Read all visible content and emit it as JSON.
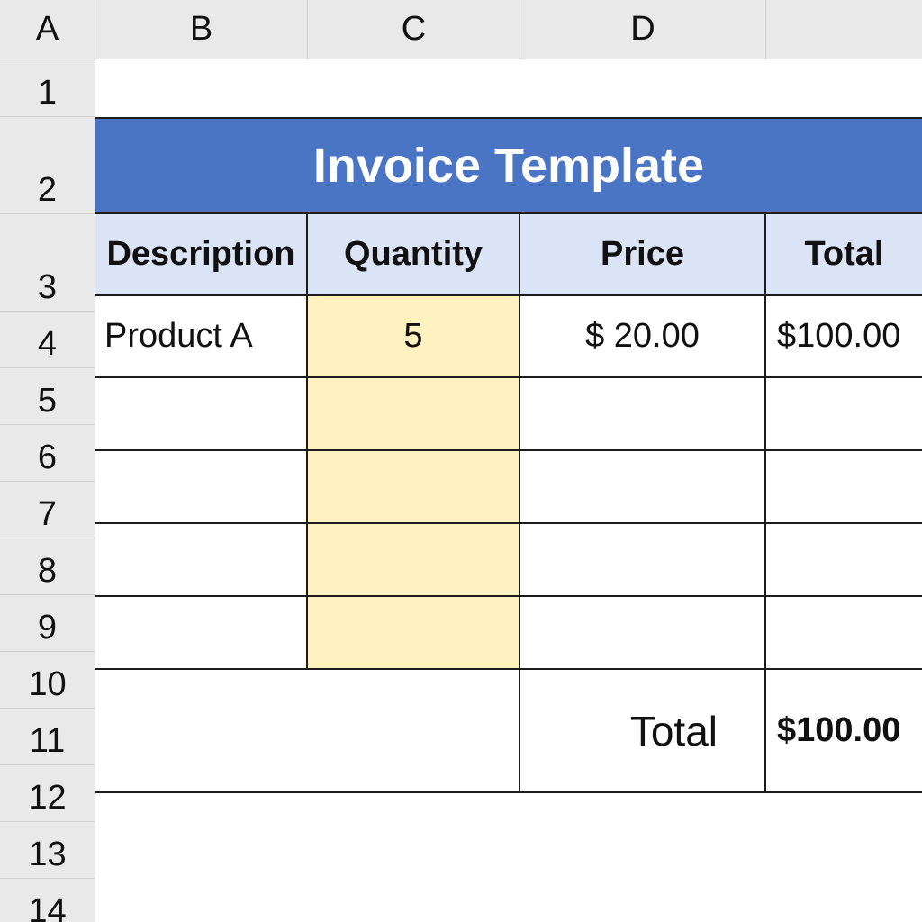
{
  "columns": [
    "A",
    "B",
    "C",
    "D"
  ],
  "rows": [
    "1",
    "2",
    "3",
    "4",
    "5",
    "6",
    "7",
    "8",
    "9",
    "10",
    "11",
    "12",
    "13",
    "14"
  ],
  "title": "Invoice Template",
  "table": {
    "headers": [
      "Description",
      "Quantity",
      "Price",
      "Total"
    ],
    "items": [
      {
        "description": "Product A",
        "quantity": "5",
        "price": "$ 20.00",
        "total": "$100.00"
      }
    ]
  },
  "summary": {
    "label": "Total",
    "value": "$100.00"
  },
  "colors": {
    "title_fill": "#4a74c4",
    "header_fill": "#dbe4f4",
    "quantity_fill": "#fff2c0",
    "grid_header": "#e9e9e9"
  }
}
